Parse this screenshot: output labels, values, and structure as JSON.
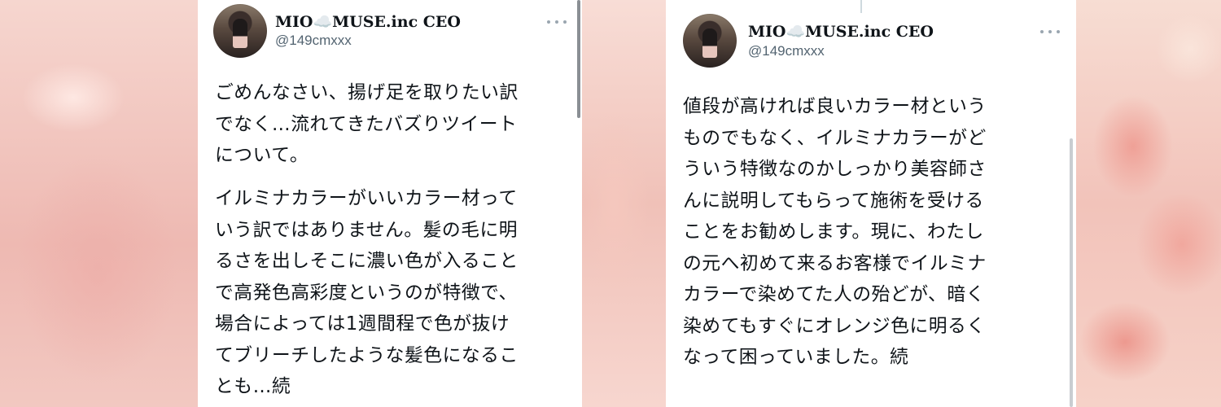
{
  "colors": {
    "card_bg": "#ffffff",
    "name_color": "#0f1419",
    "handle_color": "#536471",
    "text_color": "#0f1419"
  },
  "tweets": [
    {
      "display_name": "MIO☁️MUSE.inc CEO",
      "handle": "@149cmxxx",
      "paragraphs": [
        "ごめんなさい、揚げ足を取りたい訳\nでなく…流れてきたバズりツイート\nについて。",
        "イルミナカラーがいいカラー材って\nいう訳ではありません。髪の毛に明\nるさを出しそこに濃い色が入ること\nで高発色高彩度というのが特徴で、\n場合によっては1週間程で色が抜け\nてブリーチしたような髪色になるこ\nとも…続"
      ],
      "icons": {
        "avatar": "profile-photo",
        "more": "more-dots-icon"
      }
    },
    {
      "display_name": "MIO☁️MUSE.inc CEO",
      "handle": "@149cmxxx",
      "paragraphs": [
        "値段が高ければ良いカラー材という\nものでもなく、イルミナカラーがど\nういう特徴なのかしっかり美容師さ\nんに説明してもらって施術を受ける\nことをお勧めします。現に、わたし\nの元へ初めて来るお客様でイルミナ\nカラーで染めてた人の殆どが、暗く\n染めてもすぐにオレンジ色に明るく\nなって困っていました。続"
      ],
      "icons": {
        "avatar": "profile-photo",
        "more": "more-dots-icon"
      }
    }
  ]
}
